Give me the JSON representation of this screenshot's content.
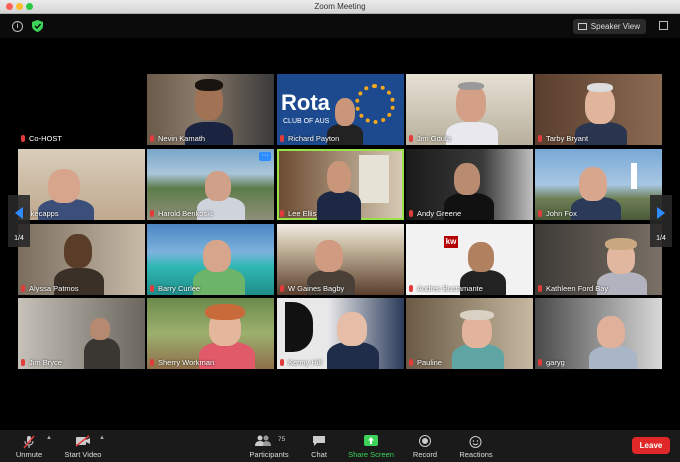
{
  "window": {
    "title": "Zoom Meeting"
  },
  "topbar": {
    "speaker_view": "Speaker View"
  },
  "nav": {
    "left_page": "1/4",
    "right_page": "1/4"
  },
  "participants": [
    {
      "name": "Co-HOST"
    },
    {
      "name": "Nevin Kamath"
    },
    {
      "name": "Richard Payton",
      "backdrop_text": "Rota",
      "backdrop_sub": "CLUB OF AUS"
    },
    {
      "name": "Jim Gdula"
    },
    {
      "name": "Tarby Bryant"
    },
    {
      "name": "ikecapps"
    },
    {
      "name": "Harold Benkoski"
    },
    {
      "name": "Lee Ellis"
    },
    {
      "name": "Andy Greene"
    },
    {
      "name": "John Fox"
    },
    {
      "name": "Alyssa Patmos"
    },
    {
      "name": "Barry Curlee"
    },
    {
      "name": "W Gaines Bagby"
    },
    {
      "name": "Andres Bustamante"
    },
    {
      "name": "Kathleen Ford Bay"
    },
    {
      "name": "Jim Bryce"
    },
    {
      "name": "Sherry Workman"
    },
    {
      "name": "Kenny Hill"
    },
    {
      "name": "Pauline"
    },
    {
      "name": "garyg"
    }
  ],
  "toolbar": {
    "unmute": "Unmute",
    "start_video": "Start Video",
    "participants": "Participants",
    "participants_count": "75",
    "chat": "Chat",
    "share_screen": "Share Screen",
    "record": "Record",
    "reactions": "Reactions",
    "leave": "Leave"
  },
  "colors": {
    "accent_green": "#3dd25a",
    "leave_red": "#e02828",
    "active_speaker": "#9be24a",
    "zoom_blue": "#2d8cff"
  }
}
